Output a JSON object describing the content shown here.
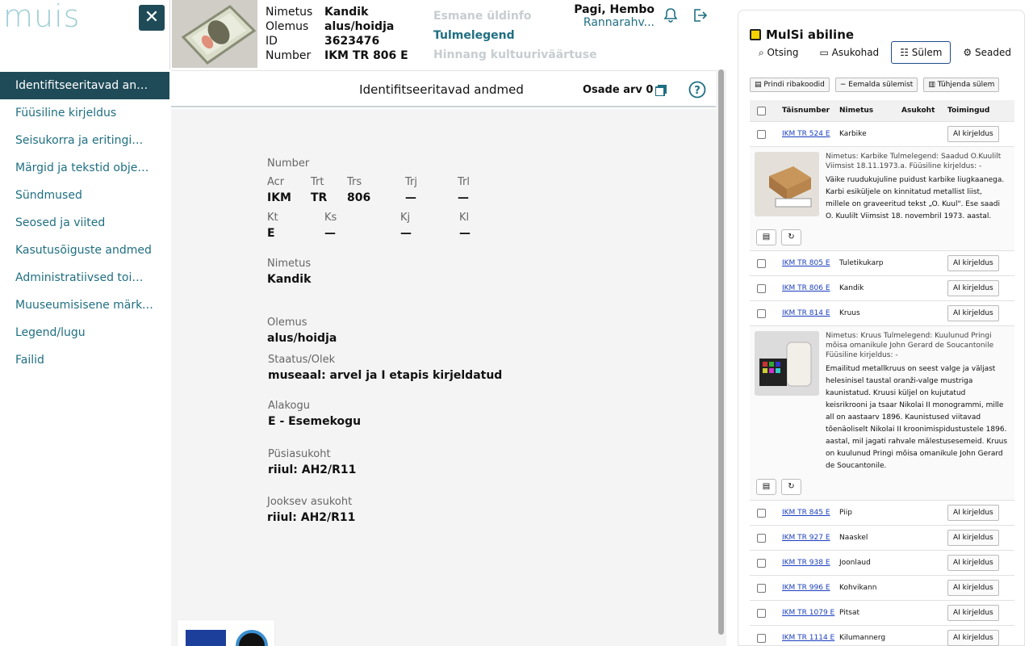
{
  "brand": {
    "logo_text": "muis",
    "close_symbol": "✕"
  },
  "sidebar": {
    "items": [
      {
        "label": "Identifitseeritavad andmed"
      },
      {
        "label": "Füüsiline kirjeldus"
      },
      {
        "label": "Seisukorra ja eritingimuste andmed"
      },
      {
        "label": "Märgid ja tekstid objektil"
      },
      {
        "label": "Sündmused"
      },
      {
        "label": "Seosed ja viited"
      },
      {
        "label": "Kasutusõiguste andmed"
      },
      {
        "label": "Administratiivsed toimingud"
      },
      {
        "label": "Muuseumisisene märkus"
      },
      {
        "label": "Legend/lugu"
      },
      {
        "label": "Failid"
      }
    ]
  },
  "header": {
    "meta": [
      {
        "label": "Nimetus",
        "value": "Kandik"
      },
      {
        "label": "Olemus",
        "value": "alus/hoidja"
      },
      {
        "label": "ID",
        "value": "3623476"
      },
      {
        "label": "Number",
        "value": "IKM TR 806 E"
      }
    ],
    "tabs": [
      {
        "label": "Esmane üldinfo",
        "active": false
      },
      {
        "label": "Tulmelegend",
        "active": true
      },
      {
        "label": "Hinnang kultuuriväärtuse",
        "active": false
      }
    ],
    "user": {
      "name": "Pagi, Hembo",
      "org": "Rannarahv..."
    }
  },
  "section": {
    "title": "Identifitseeritavad andmed",
    "parts_label": "Osade arv 0"
  },
  "details": {
    "number_label": "Number",
    "number_parts": [
      {
        "label": "Acr",
        "value": "IKM"
      },
      {
        "label": "Trt",
        "value": "TR"
      },
      {
        "label": "Trs",
        "value": "806"
      },
      {
        "label": "Trj",
        "value": "—"
      },
      {
        "label": "Trl",
        "value": "—"
      },
      {
        "label": "Kt",
        "value": "E"
      },
      {
        "label": "Ks",
        "value": "—"
      },
      {
        "label": "Kj",
        "value": "—"
      },
      {
        "label": "Kl",
        "value": "—"
      }
    ],
    "fields": [
      {
        "label": "Nimetus",
        "value": "Kandik"
      },
      {
        "label": "Olemus",
        "value": "alus/hoidja"
      },
      {
        "label": "Staatus/Olek",
        "value": "museaal: arvel ja I etapis kirjeldatud"
      },
      {
        "label": "Alakogu",
        "value": "E - Esemekogu"
      },
      {
        "label": "Püsiasukoht",
        "value": "riiul: AH2/R11"
      },
      {
        "label": "Jooksev asukoht",
        "value": "riiul: AH2/R11"
      }
    ]
  },
  "assistant": {
    "title": "MulSi abiline",
    "tabs": [
      {
        "label": "Otsing",
        "active": false
      },
      {
        "label": "Asukohad",
        "active": false
      },
      {
        "label": "Sülem",
        "active": true
      },
      {
        "label": "Seaded",
        "active": false
      }
    ],
    "toolbar": [
      "Prindi ribakoodid",
      "Eemalda sülemist",
      "Tühjenda sülem"
    ],
    "columns": [
      "Täisnumber",
      "Nimetus",
      "Asukoht",
      "Toimingud"
    ],
    "ai_label": "AI kirjeldus",
    "rows": [
      {
        "num": "IKM TR 524 E",
        "name": "Karbike"
      },
      {
        "num": "IKM TR 805 E",
        "name": "Tuletikukarp"
      },
      {
        "num": "IKM TR 806 E",
        "name": "Kandik"
      },
      {
        "num": "IKM TR 814 E",
        "name": "Kruus"
      },
      {
        "num": "IKM TR 845 E",
        "name": "Piip"
      },
      {
        "num": "IKM TR 927 E",
        "name": "Naaskel"
      },
      {
        "num": "IKM TR 938 E",
        "name": "Joonlaud"
      },
      {
        "num": "IKM TR 996 E",
        "name": "Kohvikann"
      },
      {
        "num": "IKM TR 1079 E",
        "name": "Pitsat"
      },
      {
        "num": "IKM TR 1114 E",
        "name": "Kilumannerg"
      }
    ],
    "expanded": [
      {
        "meta": "Nimetus: Karbike Tulmelegend: Saadud O.Kuulilt Viimsist 18.11.1973.a. Füüsiline kirjeldus: -",
        "desc": "Väike ruudukujuline puidust karbike liugkaanega. Karbi esiküljele on kinnitatud metallist liist, millele on graveeritud tekst „O. Kuul\". Ese saadi O. Kuulilt Viimsist 18. novembril 1973. aastal."
      },
      {
        "meta": "Nimetus: Kruus Tulmelegend: Kuulunud Pringi mõisa omanikule John Gerard de Soucantonile Füüsiline kirjeldus: -",
        "desc": "Emailitud metallkruus on seest valge ja väljast helesinisel taustal oranži-valge mustriga kaunistatud. Kruusi küljel on kujutatud keisrikrooni ja tsaar Nikolai II monogrammi, mille all on aastaarv 1896. Kaunistused viitavad tõenäoliselt Nikolai II kroonimispidustustele 1896. aastal, mil jagati rahvale mälestusesemeid. Kruus on kuulunud Pringi mõisa omanikule John Gerard de Soucantonile."
      }
    ]
  }
}
